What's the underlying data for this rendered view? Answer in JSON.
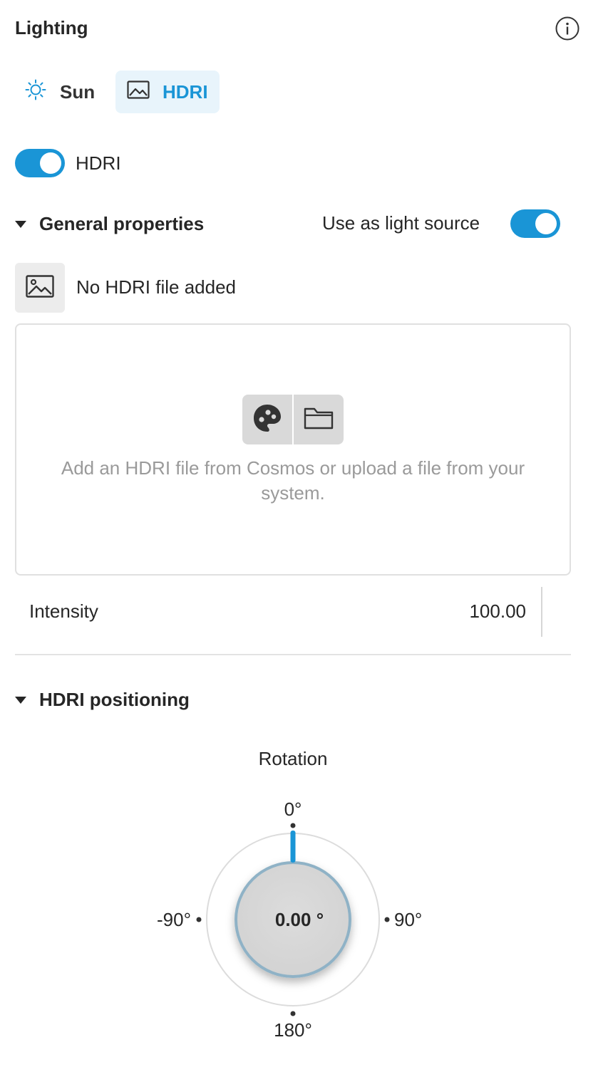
{
  "panel": {
    "title": "Lighting",
    "info_icon": "info-icon"
  },
  "tabs": [
    {
      "label": "Sun",
      "icon": "sun-icon",
      "selected": false
    },
    {
      "label": "HDRI",
      "icon": "image-icon",
      "selected": true
    }
  ],
  "hdri_toggle": {
    "label": "HDRI",
    "on": true
  },
  "general": {
    "title": "General properties",
    "light_source_label": "Use as light source",
    "light_source_on": true,
    "file_status": "No HDRI file added",
    "dropzone_text": "Add an HDRI file from Cosmos or upload a file from your system.",
    "dropzone_buttons": [
      "cosmos-palette-icon",
      "folder-icon"
    ],
    "intensity_label": "Intensity",
    "intensity_value": "100.00"
  },
  "positioning": {
    "title": "HDRI positioning",
    "rotation_label": "Rotation",
    "rotation_value": "0.00 °",
    "dial_labels": {
      "top": "0°",
      "right": "90°",
      "bottom": "180°",
      "left": "-90°"
    }
  },
  "colors": {
    "accent": "#1a95d6",
    "accent_bg": "#e8f4fb",
    "muted_text": "#9a9a9a",
    "button_bg": "#d9d9d9"
  }
}
